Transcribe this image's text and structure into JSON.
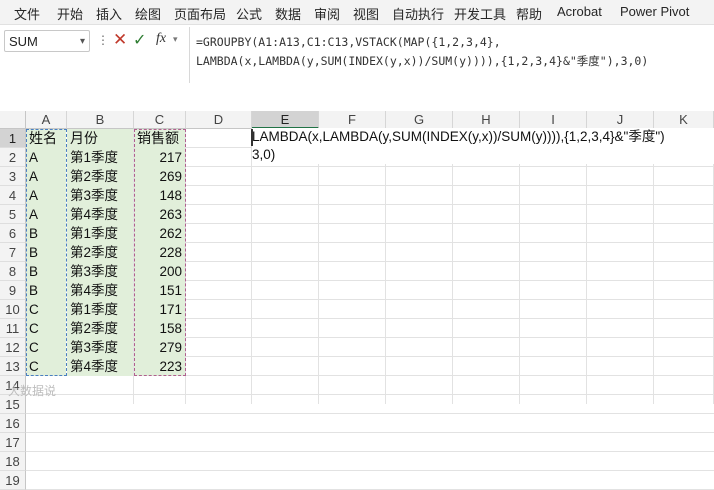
{
  "ribbon": {
    "tabs": [
      "文件",
      "开始",
      "插入",
      "绘图",
      "页面布局",
      "公式",
      "数据",
      "审阅",
      "视图",
      "自动执行",
      "开发工具",
      "帮助",
      "Acrobat",
      "Power Pivot"
    ]
  },
  "formula_bar": {
    "name_box": "SUM",
    "fx_label": "fx",
    "line1": "=GROUPBY(A1:A13,C1:C13,VSTACK(MAP({1,2,3,4},",
    "line2": "LAMBDA(x,LAMBDA(y,SUM(INDEX(y,x))/SUM(y)))),{1,2,3,4}&\"季度\"),3,0)"
  },
  "columns": [
    "A",
    "B",
    "C",
    "D",
    "E",
    "F",
    "G",
    "H",
    "I",
    "J",
    "K"
  ],
  "selected_column": "E",
  "rows": [
    "1",
    "2",
    "3",
    "4",
    "5",
    "6",
    "7",
    "8",
    "9",
    "10",
    "11",
    "12",
    "13",
    "14",
    "15",
    "16",
    "17",
    "18",
    "19"
  ],
  "selected_row": "1",
  "table": {
    "headers": [
      "姓名",
      "月份",
      "销售额"
    ],
    "rows": [
      [
        "A",
        "第1季度",
        "217"
      ],
      [
        "A",
        "第2季度",
        "269"
      ],
      [
        "A",
        "第3季度",
        "148"
      ],
      [
        "A",
        "第4季度",
        "263"
      ],
      [
        "B",
        "第1季度",
        "262"
      ],
      [
        "B",
        "第2季度",
        "228"
      ],
      [
        "B",
        "第3季度",
        "200"
      ],
      [
        "B",
        "第4季度",
        "151"
      ],
      [
        "C",
        "第1季度",
        "171"
      ],
      [
        "C",
        "第2季度",
        "158"
      ],
      [
        "C",
        "第3季度",
        "279"
      ],
      [
        "C",
        "第4季度",
        "223"
      ]
    ]
  },
  "in_cell_edit": {
    "line1": "LAMBDA(x,LAMBDA(y,SUM(INDEX(y,x))/SUM(y)))),{1,2,3,4}&\"季度\")",
    "line2": "3,0)"
  },
  "watermark": "大数据说"
}
